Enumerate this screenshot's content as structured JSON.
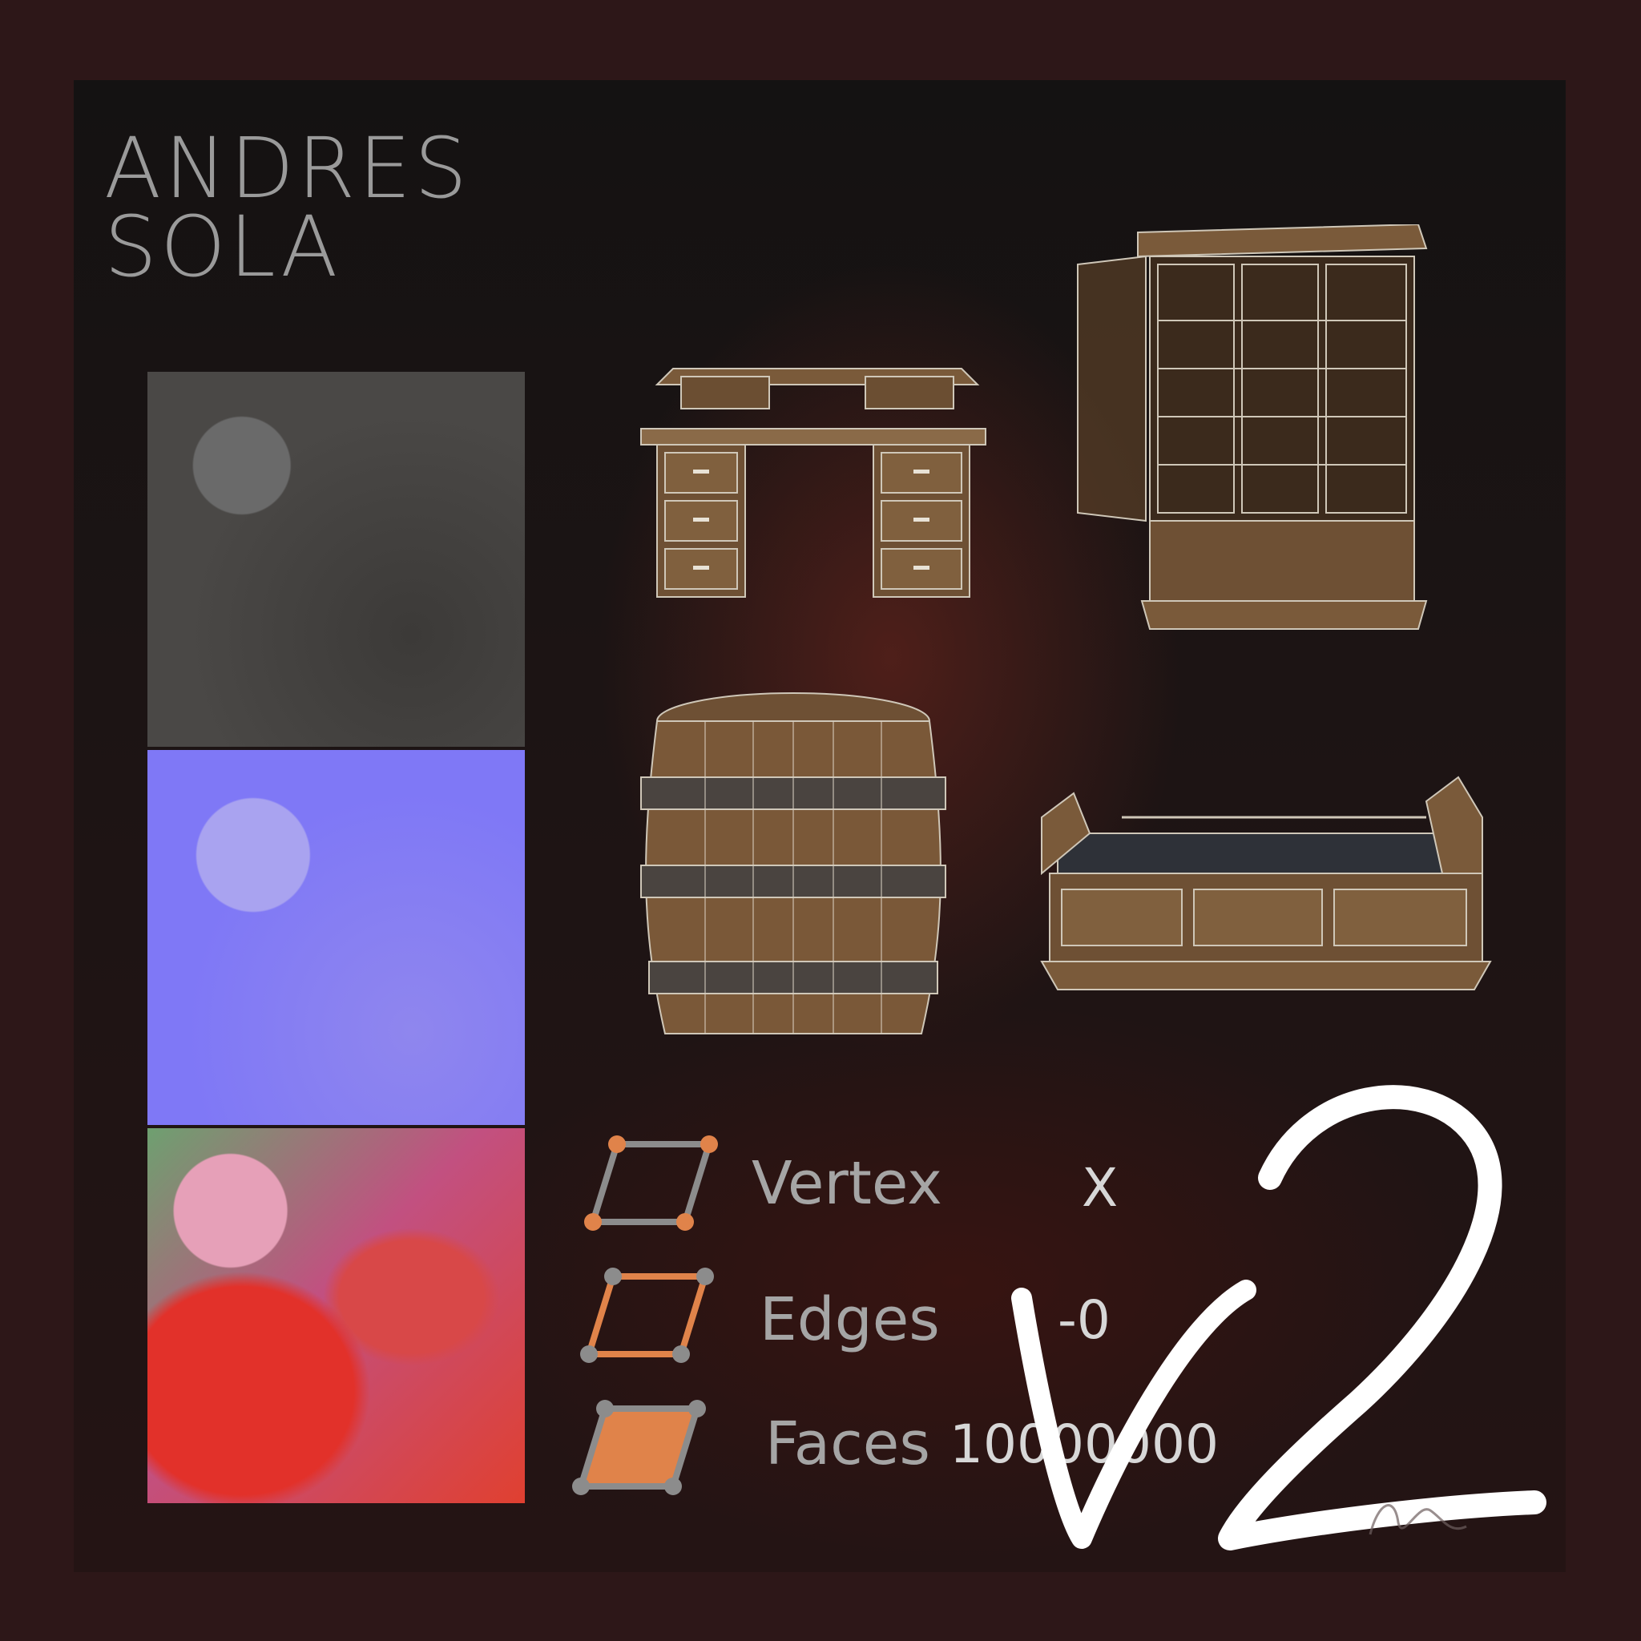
{
  "title": {
    "line1": "ANDRES",
    "line2": "SOLA"
  },
  "legend": {
    "items": [
      {
        "label": "Vertex",
        "value": "X"
      },
      {
        "label": "Edges",
        "value": "-0"
      },
      {
        "label": "Faces",
        "value": "10000000"
      }
    ]
  },
  "version": {
    "text": "V2"
  },
  "colors": {
    "accent": "#e0834a",
    "frame": "#2d1718",
    "label": "#a5a5a5"
  }
}
